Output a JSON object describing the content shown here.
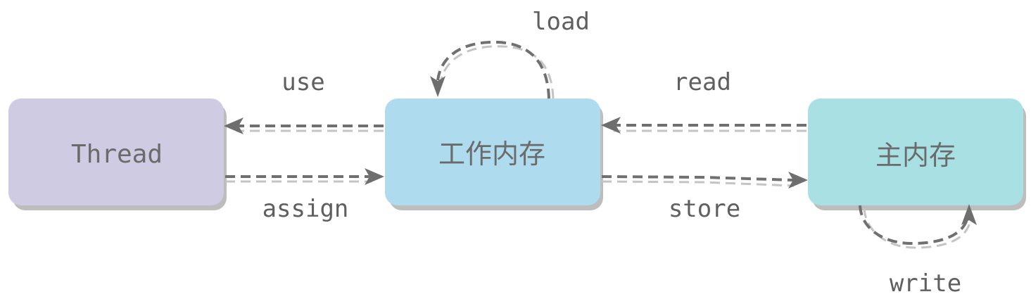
{
  "nodes": {
    "thread": {
      "label": "Thread",
      "color": "#cfcbe3"
    },
    "working_memory": {
      "label": "工作内存",
      "color": "#aedbed"
    },
    "main_memory": {
      "label": "主内存",
      "color": "#a8e0e3"
    }
  },
  "edges": {
    "use": "use",
    "assign": "assign",
    "load": "load",
    "read": "read",
    "store": "store",
    "write": "write"
  },
  "colors": {
    "arrow": "#707070",
    "arrow_shadow": "#c4c4c4",
    "node_shadow": "#bdbdbd",
    "text": "#6b6b6b"
  }
}
